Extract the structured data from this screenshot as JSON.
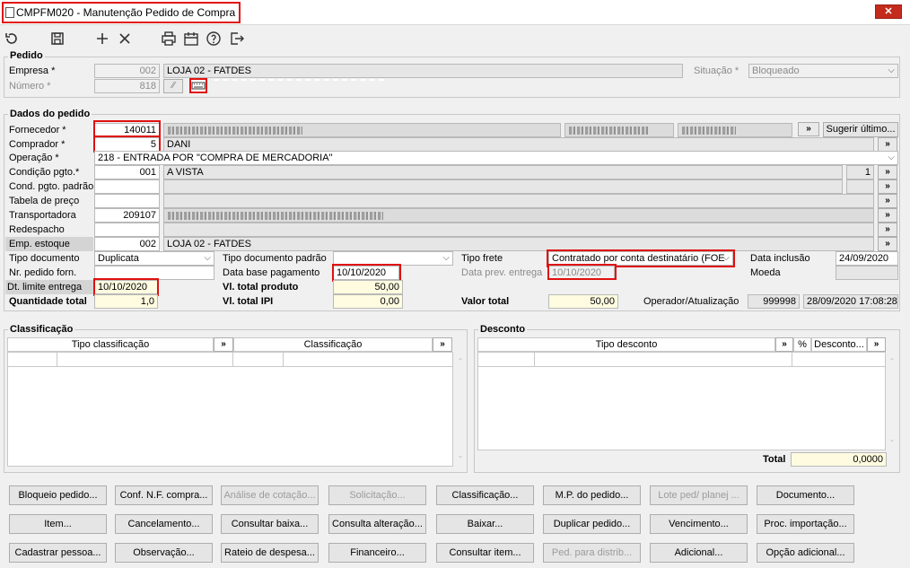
{
  "window": {
    "title": "CMPFM020 - Manutenção Pedido de Compra",
    "close": "✕"
  },
  "toolbar": [
    "undo-icon",
    "save-icon",
    "add-icon",
    "delete-icon",
    "print-icon",
    "calendar-icon",
    "help-icon",
    "exit-icon"
  ],
  "pedido": {
    "title": "Pedido",
    "empresa_label": "Empresa *",
    "empresa_code": "002",
    "empresa_name": "LOJA 02 - FATDES",
    "numero_label": "Número *",
    "numero_value": "818",
    "situacao_label": "Situação *",
    "situacao_value": "Bloqueado"
  },
  "dados": {
    "title": "Dados do pedido",
    "fornecedor_label": "Fornecedor *",
    "fornecedor_code": "140011",
    "comprador_label": "Comprador *",
    "comprador_code": "5",
    "comprador_name": "DANI",
    "operacao_label": "Operação *",
    "operacao_value": "218 - ENTRADA POR \"COMPRA DE MERCADORIA\"",
    "condicao_label": "Condição pgto.*",
    "condicao_code": "001",
    "condicao_name": "A VISTA",
    "condicao_qty": "1",
    "cond_padrao_label": "Cond. pgto. padrão",
    "tabela_label": "Tabela de preço",
    "transportadora_label": "Transportadora",
    "transportadora_code": "209107",
    "redespacho_label": "Redespacho",
    "emp_estoque_label": "Emp. estoque",
    "emp_estoque_code": "002",
    "emp_estoque_name": "LOJA 02 - FATDES",
    "sugerir_label": "Sugerir último...",
    "more": "»",
    "tipo_doc_label": "Tipo documento",
    "tipo_doc_value": "Duplicata",
    "nr_pedido_label": "Nr. pedido forn.",
    "dt_limite_label": "Dt. limite entrega",
    "dt_limite_value": "10/10/2020",
    "quantidade_label": "Quantidade total",
    "quantidade_value": "1,0",
    "tipo_doc_padrao_label": "Tipo documento padrão",
    "data_base_label": "Data base pagamento",
    "data_base_value": "10/10/2020",
    "vl_produto_label": "Vl. total produto",
    "vl_produto_value": "50,00",
    "vl_ipi_label": "Vl. total IPI",
    "vl_ipi_value": "0,00",
    "tipo_frete_label": "Tipo frete",
    "tipo_frete_value": "Contratado por conta destinatário (FOE",
    "data_prev_label": "Data prev. entrega",
    "data_prev_value": "10/10/2020",
    "valor_total_label": "Valor total",
    "valor_total_value": "50,00",
    "data_inclusao_label": "Data inclusão",
    "data_inclusao_value": "24/09/2020",
    "moeda_label": "Moeda",
    "operador_label": "Operador/Atualização",
    "operador_value": "999998",
    "atualizacao_value": "28/09/2020 17:08:28"
  },
  "classificacao": {
    "title": "Classificação",
    "col1": "Tipo classificação",
    "col2": "Classificação",
    "more": "»"
  },
  "desconto": {
    "title": "Desconto",
    "col1": "Tipo desconto",
    "col_pct": "%",
    "col_desc": "Desconto...",
    "more": "»",
    "total_label": "Total",
    "total_value": "0,0000"
  },
  "buttons": [
    [
      "Bloqueio pedido...",
      "Conf. N.F. compra...",
      "Análise de cotação...",
      "Solicitação...",
      "Classificação...",
      "M.P. do pedido...",
      "Lote ped/ planej ...",
      "Documento..."
    ],
    [
      "Item...",
      "Cancelamento...",
      "Consultar baixa...",
      "Consulta alteração...",
      "Baixar...",
      "Duplicar pedido...",
      "Vencimento...",
      "Proc. importação..."
    ],
    [
      "Cadastrar pessoa...",
      "Observação...",
      "Rateio de despesa...",
      "Financeiro...",
      "Consultar item...",
      "Ped. para distrib...",
      "Adicional...",
      "Opção adicional..."
    ]
  ],
  "disabled_buttons": [
    "Análise de cotação...",
    "Solicitação...",
    "Lote ped/ planej ...",
    "Ped. para distrib..."
  ]
}
